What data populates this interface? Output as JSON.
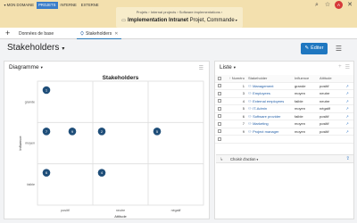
{
  "menu": {
    "items": [
      {
        "label": "MON DOMAINE",
        "arrow": "▾",
        "active": false
      },
      {
        "label": "PROJETS",
        "arrow": "",
        "active": true
      },
      {
        "label": "INTERNE",
        "arrow": "",
        "active": false
      },
      {
        "label": "EXTERNE",
        "arrow": "",
        "active": false
      }
    ],
    "icons": {
      "search": "⌕",
      "star": "☆",
      "avatar_initials": "A",
      "close": "✕"
    }
  },
  "breadcrumb": {
    "path": "Projets  ›  Internal projects  ›  Software implementations  ›",
    "object_icon": "▭",
    "title_bold": "Implementation Intranet",
    "title_rest": " Projet, Commande",
    "title_arrow": "▾"
  },
  "tabs": {
    "add_label": "+",
    "items": [
      {
        "label": "Données de base",
        "icon": "",
        "close": ""
      },
      {
        "label": "Stakeholders",
        "icon": "⛭",
        "close": "✕"
      }
    ]
  },
  "page": {
    "title": "Stakeholders",
    "title_arrow": "▾",
    "edit_label": "Éditer",
    "edit_icon": "✎",
    "settings_icon": "☰"
  },
  "left_panel": {
    "title": "Diagramme",
    "arrow": "▾",
    "menu_icon": "☰"
  },
  "chart_data": {
    "type": "scatter",
    "title": "Stakeholders",
    "xlabel": "Attitude",
    "ylabel": "Influence",
    "x_categories": [
      "positif",
      "neutre",
      "négatif"
    ],
    "y_categories": [
      "faible",
      "moyen",
      "grande"
    ],
    "points": [
      {
        "label": "1",
        "x": "positif",
        "y": "grande",
        "offset": 0
      },
      {
        "label": "7",
        "x": "positif",
        "y": "moyen",
        "offset": 0
      },
      {
        "label": "9",
        "x": "positif",
        "y": "moyen",
        "offset": 1
      },
      {
        "label": "2",
        "x": "neutre",
        "y": "moyen",
        "offset": 0
      },
      {
        "label": "5",
        "x": "négatif",
        "y": "moyen",
        "offset": 0
      },
      {
        "label": "6",
        "x": "positif",
        "y": "faible",
        "offset": 0
      },
      {
        "label": "4",
        "x": "neutre",
        "y": "faible",
        "offset": 0
      }
    ],
    "colors": {
      "point": "#1f4e79",
      "point_text": "#ffffff",
      "grid": "#dddddd"
    }
  },
  "right_panel": {
    "title": "Liste",
    "arrow": "▾",
    "add_icon": "+",
    "menu_icon": "☰",
    "columns": {
      "number": "Numéro",
      "sort": "↑",
      "stakeholder": "Stakeholder",
      "influence": "Influence",
      "attitude": "Attitude"
    },
    "person_icon": "⚇",
    "open_icon": "↗",
    "rows": [
      {
        "number": "1",
        "name": "Management",
        "influence": "grande",
        "attitude": "positif"
      },
      {
        "number": "3",
        "name": "Employees",
        "influence": "moyen",
        "attitude": "neutre"
      },
      {
        "number": "4",
        "name": "External employees",
        "influence": "faible",
        "attitude": "neutre"
      },
      {
        "number": "5",
        "name": "IT-Admin",
        "influence": "moyen",
        "attitude": "négatif"
      },
      {
        "number": "6",
        "name": "Software provider",
        "influence": "faible",
        "attitude": "positif"
      },
      {
        "number": "7",
        "name": "Marketing",
        "influence": "moyen",
        "attitude": "positif"
      },
      {
        "number": "9",
        "name": "Project manager",
        "influence": "moyen",
        "attitude": "positif"
      }
    ],
    "action_arrow": "↳",
    "action_label": "Choisir d'action",
    "action_arrow_down": "▾",
    "export_icon": "⇪"
  }
}
